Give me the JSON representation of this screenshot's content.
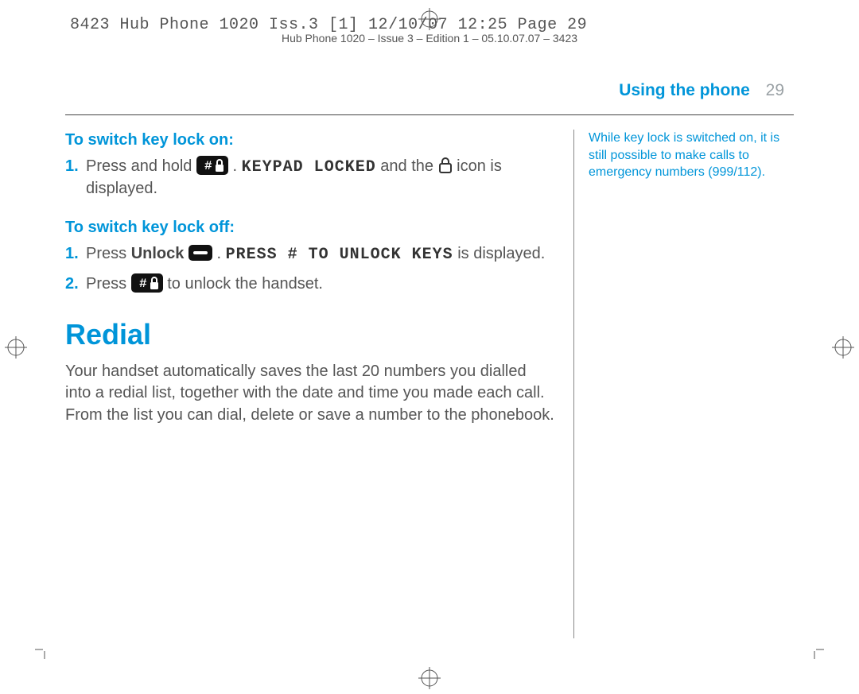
{
  "slug1": "8423 Hub Phone 1020 Iss.3 [1]  12/10/07  12:25  Page 29",
  "slug2": "Hub Phone 1020 – Issue 3 – Edition 1 – 05.10.07.07 – 3423",
  "runhead": {
    "title": "Using the phone",
    "pageno": "29"
  },
  "side_note": "While key lock is switched on, it is still possible to make calls to emergency numbers (999/112).",
  "keylock_on": {
    "heading": "To switch key lock on:",
    "step1_a": "Press and hold ",
    "step1_disp": "KEYPAD LOCKED",
    "step1_b": " and the ",
    "step1_c": " icon is displayed."
  },
  "keylock_off": {
    "heading": "To switch key lock off:",
    "step1_a": "Press ",
    "step1_unlock": "Unlock",
    "step1_disp": "PRESS # TO UNLOCK KEYS",
    "step1_b": " is displayed.",
    "step2_a": "Press ",
    "step2_b": " to unlock the handset."
  },
  "redial": {
    "heading": "Redial",
    "para": "Your handset automatically saves the last 20 numbers you dialled into a redial list, together with the date and time you made each call. From the list you can dial, delete or save a number to the phonebook."
  }
}
